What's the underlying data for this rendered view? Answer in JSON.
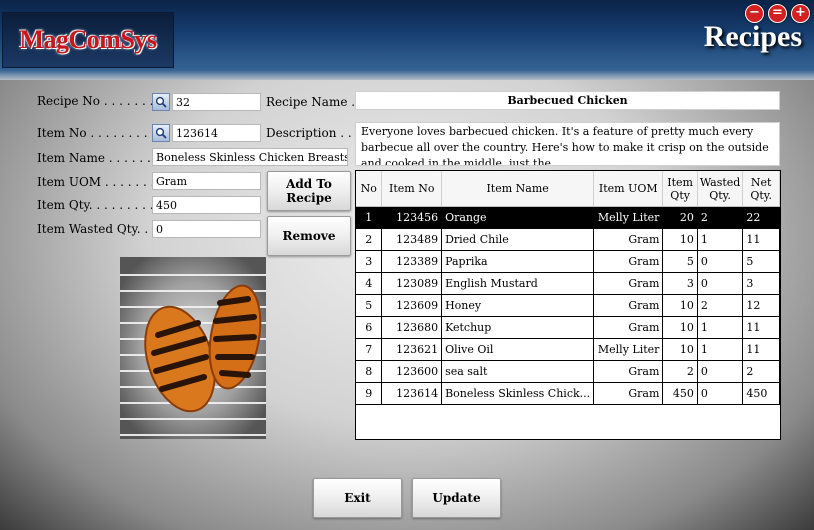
{
  "header": {
    "logo_text": "MagComSys",
    "title": "Recipes",
    "window_buttons": [
      "−",
      "=",
      "+"
    ]
  },
  "form": {
    "recipe_no_label": "Recipe No . . . . . . . .",
    "recipe_no_value": "32",
    "recipe_name_label": "Recipe Name . .",
    "recipe_name_value": "Barbecued Chicken",
    "item_no_label": "Item No . . . . . . . . . .",
    "item_no_value": "123614",
    "description_label": "Description . . .",
    "description_value": "Everyone loves barbecued chicken. It's a feature of pretty much every barbecue all over the country. Here's how to make it crisp on the outside and cooked in the middle, just the",
    "item_name_label": "Item Name . . . . . . . .",
    "item_name_value": "Boneless Skinless Chicken Breasts",
    "item_uom_label": "Item UOM . . . . . . . .",
    "item_uom_value": "Gram",
    "item_qty_label": "Item Qty. . . . . . . . . . .",
    "item_qty_value": "450",
    "item_wasted_label": "Item Wasted Qty. . .",
    "item_wasted_value": "0"
  },
  "buttons": {
    "add_to_recipe": "Add To Recipe",
    "remove": "Remove",
    "exit": "Exit",
    "update": "Update"
  },
  "grid": {
    "columns": [
      "No",
      "Item No",
      "Item Name",
      "Item UOM",
      "Item Qty",
      "Wasted Qty.",
      "Net Qty."
    ],
    "rows": [
      {
        "no": "1",
        "item_no": "123456",
        "name": "Orange",
        "uom": "Melly Liter",
        "qty": "20",
        "wasted": "2",
        "net": "22"
      },
      {
        "no": "2",
        "item_no": "123489",
        "name": "Dried Chile",
        "uom": "Gram",
        "qty": "10",
        "wasted": "1",
        "net": "11"
      },
      {
        "no": "3",
        "item_no": "123389",
        "name": "Paprika",
        "uom": "Gram",
        "qty": "5",
        "wasted": "0",
        "net": "5"
      },
      {
        "no": "4",
        "item_no": "123089",
        "name": "English Mustard",
        "uom": "Gram",
        "qty": "3",
        "wasted": "0",
        "net": "3"
      },
      {
        "no": "5",
        "item_no": "123609",
        "name": "Honey",
        "uom": "Gram",
        "qty": "10",
        "wasted": "2",
        "net": "12"
      },
      {
        "no": "6",
        "item_no": "123680",
        "name": "Ketchup",
        "uom": "Gram",
        "qty": "10",
        "wasted": "1",
        "net": "11"
      },
      {
        "no": "7",
        "item_no": "123621",
        "name": "Olive Oil",
        "uom": "Melly Liter",
        "qty": "10",
        "wasted": "1",
        "net": "11"
      },
      {
        "no": "8",
        "item_no": "123600",
        "name": "sea salt",
        "uom": "Gram",
        "qty": "2",
        "wasted": "0",
        "net": "2"
      },
      {
        "no": "9",
        "item_no": "123614",
        "name": "Boneless Skinless Chick...",
        "uom": "Gram",
        "qty": "450",
        "wasted": "0",
        "net": "450"
      }
    ]
  },
  "colors": {
    "header_blue": "#163d6f",
    "logo_red": "#c8161c",
    "window_button_red": "#d42020",
    "selected_row": "#000000"
  },
  "icons": {
    "lookup": "magnifier-icon"
  }
}
